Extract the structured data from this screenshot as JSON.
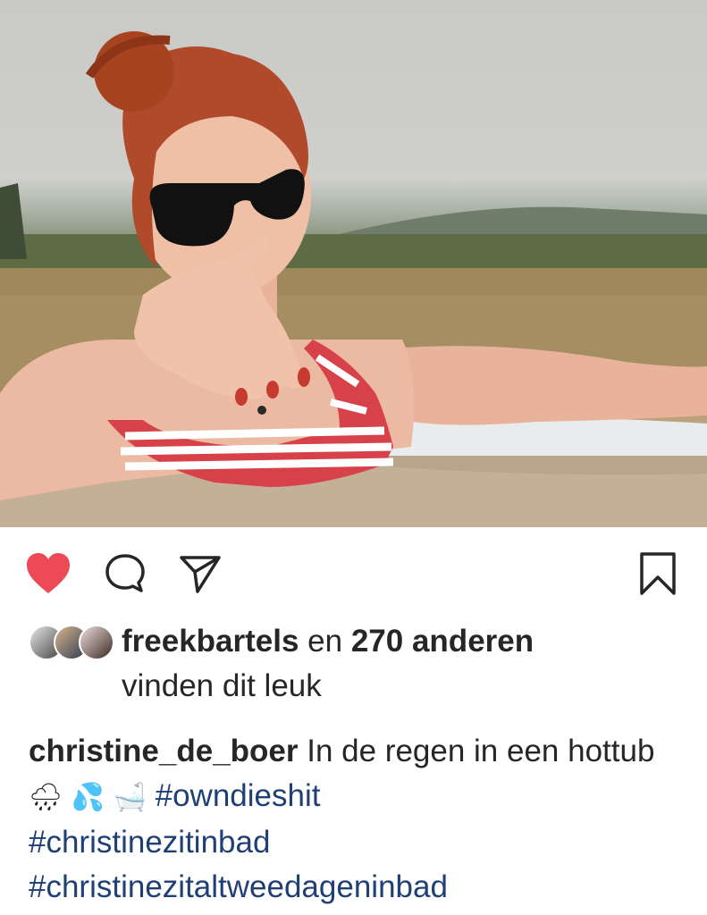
{
  "post": {
    "photo_alt": "woman in red-white striped bikini in a hot tub pointing at the camera",
    "actions": {
      "like_icon": "heart-filled-icon",
      "comment_icon": "comment-bubble-icon",
      "share_icon": "paper-plane-icon",
      "save_icon": "bookmark-icon"
    },
    "likes": {
      "first_user": "freekbartels",
      "connector": " en ",
      "others": "270 anderen",
      "suffix": "vinden dit leuk"
    },
    "caption": {
      "username": "christine_de_boer",
      "text": " In de regen in een hottub ",
      "emojis": "🌧 💦 🛁",
      "hashtags": [
        "#owndieshit",
        "#christinezitinbad",
        "#christinezitaltweedageninbad"
      ]
    }
  },
  "colors": {
    "like_red": "#ed4956",
    "hashtag_blue": "#1f3f75",
    "text": "#262626"
  }
}
